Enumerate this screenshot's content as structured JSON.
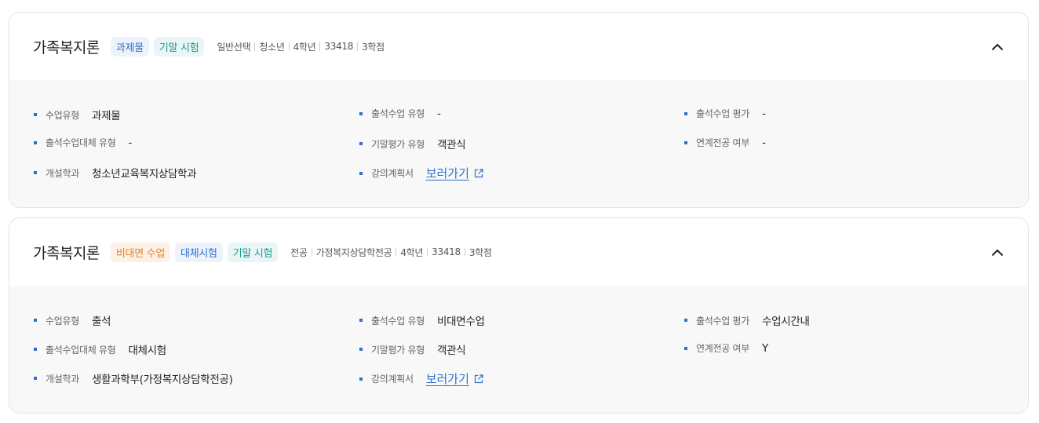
{
  "courses": [
    {
      "title": "가족복지론",
      "badges": [
        {
          "label": "과제물",
          "color": "#2f6fc8"
        },
        {
          "label": "기말 시험",
          "color": "#1a9a8e"
        }
      ],
      "meta": [
        "일반선택",
        "청소년",
        "4학년",
        "33418",
        "3학점"
      ],
      "details": {
        "class_type": {
          "label": "수업유형",
          "value": "과제물"
        },
        "attend_type": {
          "label": "출석수업 유형",
          "value": "-"
        },
        "attend_eval": {
          "label": "출석수업 평가",
          "value": "-"
        },
        "attend_alt_type": {
          "label": "출석수업대체 유형",
          "value": "-"
        },
        "final_eval_type": {
          "label": "기말평가 유형",
          "value": "객관식"
        },
        "linked_major": {
          "label": "연계전공 여부",
          "value": "-"
        },
        "department": {
          "label": "개설학과",
          "value": "청소년교육복지상담학과"
        },
        "syllabus": {
          "label": "강의계획서",
          "link": "보러가기"
        }
      }
    },
    {
      "title": "가족복지론",
      "badges": [
        {
          "label": "비대면 수업",
          "color": "#e6812a"
        },
        {
          "label": "대체시험",
          "color": "#2f6fc8"
        },
        {
          "label": "기말 시험",
          "color": "#1a9a8e"
        }
      ],
      "meta": [
        "전공",
        "가정복지상담학전공",
        "4학년",
        "33418",
        "3학점"
      ],
      "details": {
        "class_type": {
          "label": "수업유형",
          "value": "출석"
        },
        "attend_type": {
          "label": "출석수업 유형",
          "value": "비대면수업"
        },
        "attend_eval": {
          "label": "출석수업 평가",
          "value": "수업시간내"
        },
        "attend_alt_type": {
          "label": "출석수업대체 유형",
          "value": "대체시험"
        },
        "final_eval_type": {
          "label": "기말평가 유형",
          "value": "객관식"
        },
        "linked_major": {
          "label": "연계전공 여부",
          "value": "Y"
        },
        "department": {
          "label": "개설학과",
          "value": "생활과학부(가정복지상담학전공)"
        },
        "syllabus": {
          "label": "강의계획서",
          "link": "보러가기"
        }
      }
    }
  ],
  "icons": {
    "collapse": "chevron-up-icon",
    "external": "external-link-icon"
  },
  "colors": {
    "accent": "#2f6fc8",
    "bullet": "#2f6fc8",
    "body_bg": "#f8f8f9",
    "border": "#e2e4e8"
  }
}
